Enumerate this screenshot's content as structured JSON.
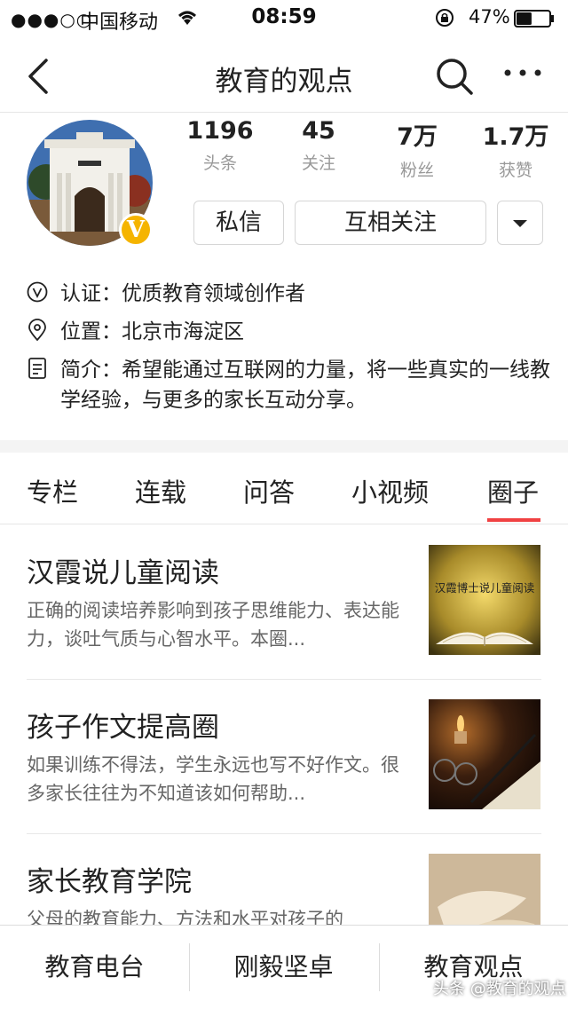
{
  "status_bar": {
    "signal": "●●●○○",
    "carrier": "中国移动",
    "time": "08:59",
    "battery_pct": "47%",
    "battery_level": 0.47
  },
  "nav": {
    "title": "教育的观点"
  },
  "profile": {
    "stats": [
      {
        "num": "1196",
        "label": "头条"
      },
      {
        "num": "45",
        "label": "关注"
      },
      {
        "num": "7万",
        "label": "粉丝"
      },
      {
        "num": "1.7万",
        "label": "获赞"
      }
    ],
    "badge": "V",
    "message_btn": "私信",
    "follow_btn": "互相关注",
    "cert": "认证：优质教育领域创作者",
    "location": "位置：北京市海淀区",
    "intro": "简介：希望能通过互联网的力量，将一些真实的一线教学经验，与更多的家长互动分享。"
  },
  "tabs": [
    "专栏",
    "连载",
    "问答",
    "小视频",
    "圈子"
  ],
  "active_tab": "圈子",
  "items": [
    {
      "title": "汉霞说儿童阅读",
      "desc": "正确的阅读培养影响到孩子思维能力、表达能力，谈吐气质与心智水平。本圈...",
      "thumb_text": "汉霞博士说儿童阅读"
    },
    {
      "title": "孩子作文提高圈",
      "desc": "如果训练不得法，学生永远也写不好作文。很多家长往往为不知道该如何帮助..."
    },
    {
      "title": "家长教育学院",
      "desc": "父母的教育能力、方法和水平对孩子的"
    }
  ],
  "bottom_bar": [
    "教育电台",
    "刚毅坚卓",
    "教育观点"
  ],
  "watermark": "头条 @教育的观点",
  "colors": {
    "accent": "#f04142",
    "badge": "#f5b400"
  }
}
